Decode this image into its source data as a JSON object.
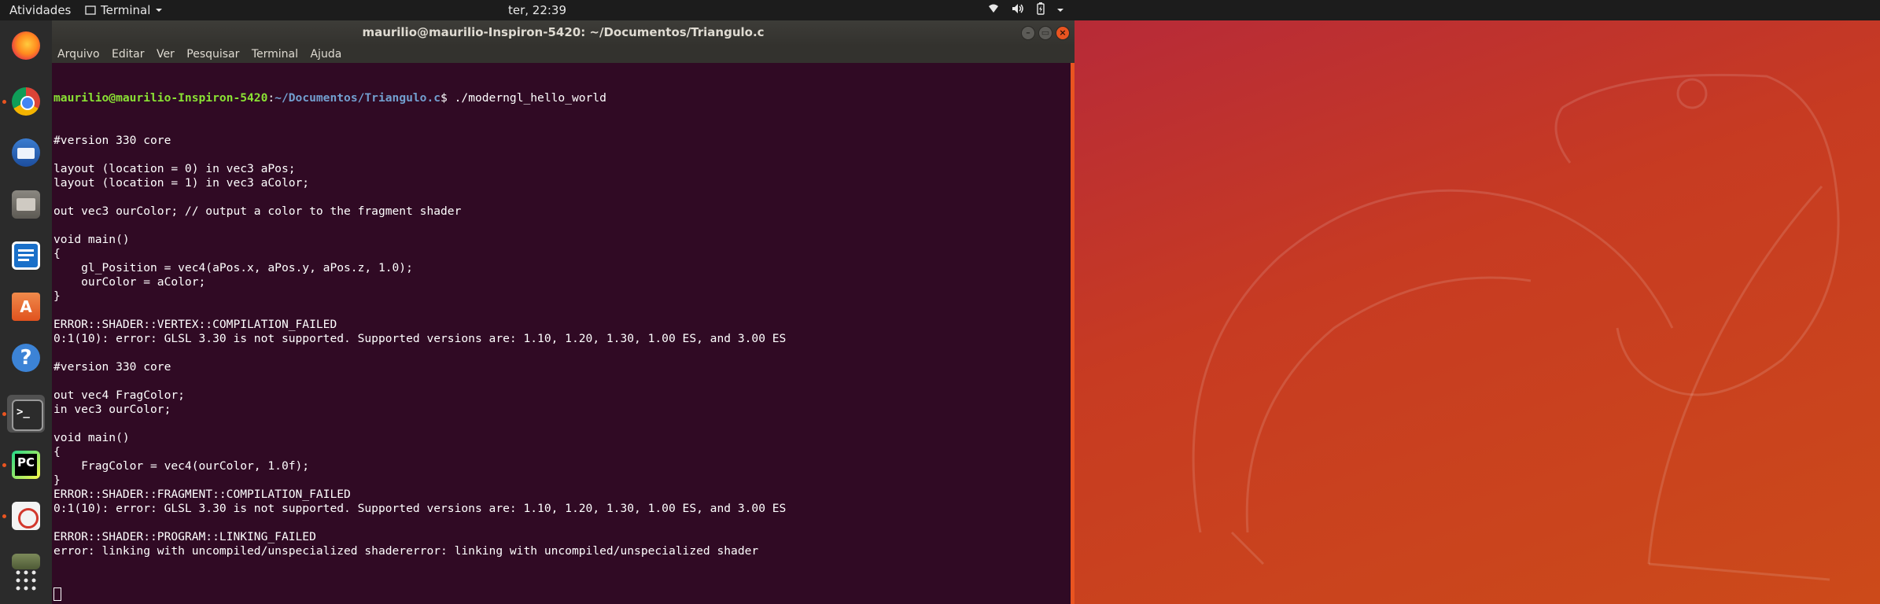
{
  "topbar": {
    "activities": "Atividades",
    "app_name": "Terminal",
    "clock": "ter, 22:39"
  },
  "dock": {
    "items": [
      {
        "name": "firefox",
        "running": false
      },
      {
        "name": "chrome",
        "running": true
      },
      {
        "name": "thunderbird",
        "running": false
      },
      {
        "name": "files",
        "running": false
      },
      {
        "name": "libreoffice-writer",
        "running": false
      },
      {
        "name": "software-center",
        "running": false
      },
      {
        "name": "help",
        "running": false
      },
      {
        "name": "terminal",
        "running": true,
        "active": true
      },
      {
        "name": "pycharm",
        "running": true
      },
      {
        "name": "document-viewer",
        "running": true
      },
      {
        "name": "image-viewer",
        "running": false
      },
      {
        "name": "show-applications",
        "running": false
      }
    ]
  },
  "window": {
    "title": "maurilio@maurilio-Inspiron-5420: ~/Documentos/Triangulo.c",
    "menu": [
      "Arquivo",
      "Editar",
      "Ver",
      "Pesquisar",
      "Terminal",
      "Ajuda"
    ]
  },
  "terminal": {
    "prompt_user": "maurilio@maurilio-Inspiron-5420",
    "prompt_path": "~/Documentos/Triangulo.c",
    "prompt_sym": "$ ",
    "command": "./moderngl_hello_world",
    "lines": [
      "#version 330 core",
      "",
      "layout (location = 0) in vec3 aPos;",
      "layout (location = 1) in vec3 aColor;",
      "",
      "out vec3 ourColor; // output a color to the fragment shader",
      "",
      "void main()",
      "{",
      "    gl_Position = vec4(aPos.x, aPos.y, aPos.z, 1.0);",
      "    ourColor = aColor;",
      "}",
      "",
      "ERROR::SHADER::VERTEX::COMPILATION_FAILED",
      "0:1(10): error: GLSL 3.30 is not supported. Supported versions are: 1.10, 1.20, 1.30, 1.00 ES, and 3.00 ES",
      "",
      "#version 330 core",
      "",
      "out vec4 FragColor;",
      "in vec3 ourColor;",
      "",
      "void main()",
      "{",
      "    FragColor = vec4(ourColor, 1.0f);",
      "}",
      "ERROR::SHADER::FRAGMENT::COMPILATION_FAILED",
      "0:1(10): error: GLSL 3.30 is not supported. Supported versions are: 1.10, 1.20, 1.30, 1.00 ES, and 3.00 ES",
      "",
      "ERROR::SHADER::PROGRAM::LINKING_FAILED",
      "error: linking with uncompiled/unspecialized shadererror: linking with uncompiled/unspecialized shader"
    ]
  },
  "colors": {
    "terminal_bg": "#300a24",
    "accent": "#e95420",
    "prompt_user": "#8ae234",
    "prompt_path": "#729fcf"
  }
}
